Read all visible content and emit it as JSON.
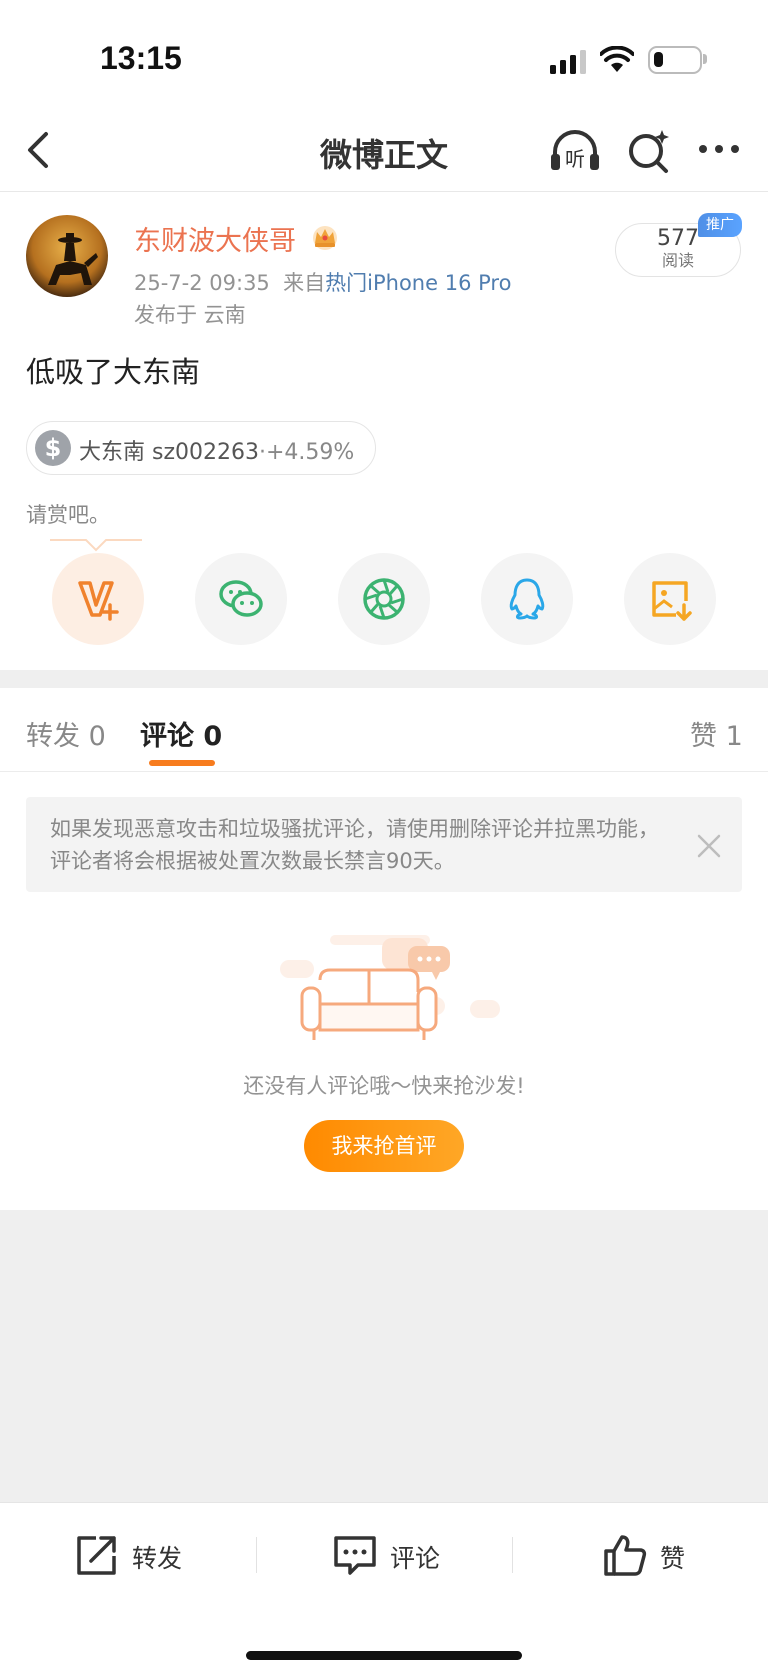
{
  "status_bar": {
    "time": "13:15",
    "battery_level": 0.2
  },
  "nav": {
    "title": "微博正文",
    "listen_icon_text": "听"
  },
  "post": {
    "username": "东财波大侠哥",
    "date": "25-7-2 09:35",
    "source_prefix": "来自",
    "source": "热门iPhone 16 Pro",
    "location": "发布于 云南",
    "read_count": "577",
    "read_label": "阅读",
    "promo_badge": "推广",
    "text": "低吸了大东南",
    "stock": {
      "icon": "$",
      "name": "大东南 sz002263",
      "change": "·+4.59%"
    },
    "reward_text": "请赏吧。"
  },
  "share": {
    "items": [
      {
        "name": "vplus-icon",
        "color": "#f0822d"
      },
      {
        "name": "wechat-icon",
        "color": "#3cb371"
      },
      {
        "name": "moments-icon",
        "color": "#3cb371"
      },
      {
        "name": "qq-icon",
        "color": "#2aa7e8"
      },
      {
        "name": "save-image-icon",
        "color": "#f5a623"
      }
    ]
  },
  "tabs": {
    "repost": "转发 0",
    "comment": "评论 0",
    "like": "赞 1"
  },
  "notice": {
    "text": "如果发现恶意攻击和垃圾骚扰评论，请使用删除评论并拉黑功能，评论者将会根据被处置次数最长禁言90天。"
  },
  "empty": {
    "text": "还没有人评论哦～快来抢沙发!",
    "button": "我来抢首评"
  },
  "bottom": {
    "repost": "转发",
    "comment": "评论",
    "like": "赞"
  },
  "colors": {
    "accent": "#f77c1e",
    "username": "#eb7350",
    "link": "#507daf"
  }
}
